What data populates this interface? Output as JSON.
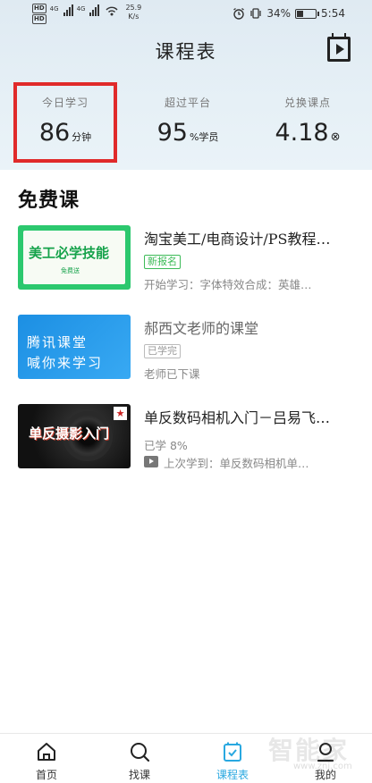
{
  "status_bar": {
    "hd1": "HD",
    "hd2": "HD",
    "net1": "4G",
    "net2": "4G",
    "speed_value": "25.9",
    "speed_unit": "K/s",
    "battery": "34%",
    "battery_level": 0.34,
    "time": "5:54"
  },
  "header": {
    "title": "课程表"
  },
  "stats": [
    {
      "label": "今日学习",
      "value": "86",
      "unit": "分钟"
    },
    {
      "label": "超过平台",
      "value": "95",
      "unit": "%学员"
    },
    {
      "label": "兑换课点",
      "value": "4.18",
      "unit": "⊗"
    }
  ],
  "free_section": {
    "title": "免费课",
    "courses": [
      {
        "title": "淘宝美工/电商设计/PS教程…",
        "badge": "新报名",
        "subtitle": "开始学习：字体特效合成：英雄…",
        "thumb_text": "美工必学技能",
        "thumb_sub": "免费送"
      },
      {
        "title": "郝西文老师的课堂",
        "badge": "已学完",
        "subtitle": "老师已下课",
        "thumb_line1": "腾讯课堂",
        "thumb_line2": "喊你来学习"
      },
      {
        "title": "单反数码相机入门－吕易飞…",
        "progress": "已学 8%",
        "subtitle": "上次学到：单反数码相机单…",
        "thumb_text": "单反摄影入门",
        "thumb_star": "★"
      }
    ]
  },
  "tab_bar": {
    "tabs": [
      {
        "label": "首页",
        "icon": "home-icon"
      },
      {
        "label": "找课",
        "icon": "search-icon"
      },
      {
        "label": "课程表",
        "icon": "schedule-icon"
      },
      {
        "label": "我的",
        "icon": "profile-icon"
      }
    ],
    "active_index": 2,
    "accent": "#29a8e0"
  },
  "watermark": {
    "text": "智能家",
    "url": "www.znj.com"
  },
  "highlight_color": "#e02a2a"
}
